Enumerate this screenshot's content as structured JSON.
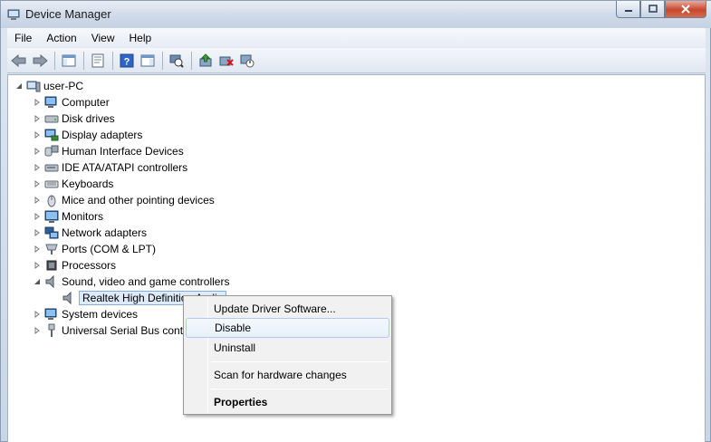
{
  "window": {
    "title": "Device Manager"
  },
  "menubar": {
    "items": [
      "File",
      "Action",
      "View",
      "Help"
    ]
  },
  "toolbar": {
    "buttons": [
      "back-icon",
      "forward-icon",
      "show-hide-console-tree-icon",
      "properties-icon",
      "help-icon",
      "action-pane-icon",
      "scan-hardware-icon",
      "update-driver-icon",
      "uninstall-icon",
      "disable-device-icon"
    ]
  },
  "tree": {
    "root": "user-PC",
    "categories": [
      "Computer",
      "Disk drives",
      "Display adapters",
      "Human Interface Devices",
      "IDE ATA/ATAPI controllers",
      "Keyboards",
      "Mice and other pointing devices",
      "Monitors",
      "Network adapters",
      "Ports (COM & LPT)",
      "Processors",
      "Sound, video and game controllers"
    ],
    "selected_device": "Realtek High Definition Audio",
    "after_categories": [
      "System devices",
      "Universal Serial Bus contr"
    ]
  },
  "context_menu": {
    "items": [
      "Update Driver Software...",
      "Disable",
      "Uninstall",
      "Scan for hardware changes",
      "Properties"
    ],
    "highlighted": "Disable"
  }
}
